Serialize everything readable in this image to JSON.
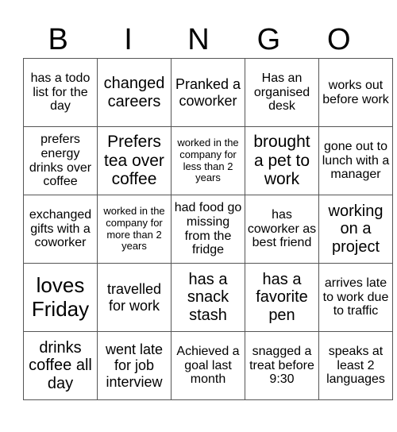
{
  "card": {
    "header_letters": [
      "B",
      "I",
      "N",
      "G",
      "O"
    ],
    "rows": [
      [
        "has a todo list for the day",
        "changed careers",
        "Pranked a coworker",
        "Has an organised desk",
        "works out before work"
      ],
      [
        "prefers energy drinks over coffee",
        "Prefers tea over coffee",
        "worked in the company for less than 2 years",
        "brought a pet to work",
        "gone out to lunch with a manager"
      ],
      [
        "exchanged gifts with a coworker",
        "worked in the company for more than 2 years",
        "had food go missing from the fridge",
        "has coworker as best friend",
        "working on a project"
      ],
      [
        "loves Friday",
        "travelled for work",
        "has a snack stash",
        "has a favorite pen",
        "arrives late to work due to traffic"
      ],
      [
        "drinks coffee all day",
        "went late for job interview",
        "Achieved a goal last month",
        "snagged a treat before 9:30",
        "speaks at least 2 languages"
      ]
    ]
  }
}
